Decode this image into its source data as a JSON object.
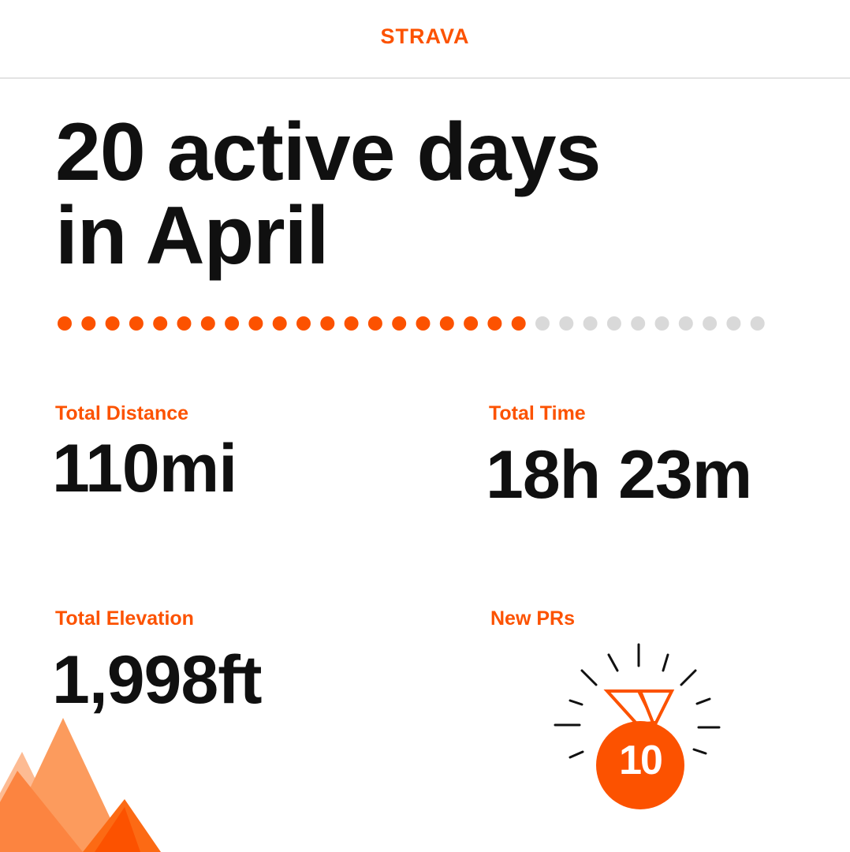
{
  "brand": {
    "name": "STRAVA"
  },
  "headline": {
    "line1": "20 active days",
    "line2": "in April"
  },
  "calendar": {
    "active_days": 20,
    "total_days": 30,
    "active_color": "#fc5200",
    "inactive_color": "#d9d9d9"
  },
  "stats": {
    "distance": {
      "label": "Total Distance",
      "value": "110mi"
    },
    "time": {
      "label": "Total Time",
      "value": "18h 23m"
    },
    "elevation": {
      "label": "Total Elevation",
      "value": "1,998ft"
    },
    "prs": {
      "label": "New PRs",
      "count": "10",
      "icon": "medal-icon"
    }
  },
  "colors": {
    "accent": "#fc5200",
    "text": "#101010",
    "divider": "#e3e3e3"
  },
  "decor": {
    "icon": "mountain-icon"
  }
}
